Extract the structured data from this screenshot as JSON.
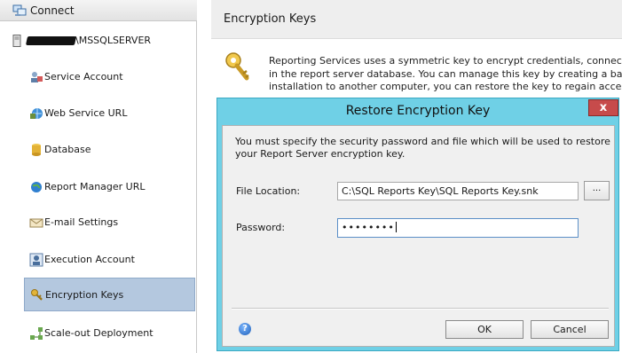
{
  "sidebar": {
    "connect_label": "Connect",
    "server_label": "\\MSSQLSERVER",
    "items": [
      {
        "label": "Service Account",
        "icon": "service-account-icon"
      },
      {
        "label": "Web Service URL",
        "icon": "web-service-icon"
      },
      {
        "label": "Database",
        "icon": "database-icon"
      },
      {
        "label": "Report Manager URL",
        "icon": "globe-icon"
      },
      {
        "label": "E-mail Settings",
        "icon": "email-icon"
      },
      {
        "label": "Execution Account",
        "icon": "execution-account-icon"
      },
      {
        "label": "Encryption Keys",
        "icon": "key-icon",
        "selected": true
      },
      {
        "label": "Scale-out Deployment",
        "icon": "scale-out-icon"
      }
    ],
    "selected_color": "#b4c8df"
  },
  "main": {
    "title": "Encryption Keys",
    "description": [
      "Reporting Services uses a symmetric key to encrypt credentials, connection stri",
      "in the report server database.  You can manage this key by creating a backup.",
      "installation to another computer, you can restore the key to regain access to en"
    ]
  },
  "dialog": {
    "title": "Restore Encryption Key",
    "close_label": "x",
    "message": "You must specify the security password and file which will be used to restore your Report Server encryption key.",
    "file_location_label": "File Location:",
    "file_location_value": "C:\\SQL Reports Key\\SQL Reports Key.snk",
    "browse_label": "...",
    "password_label": "Password:",
    "password_value": "••••••••",
    "ok_label": "OK",
    "cancel_label": "Cancel",
    "accent_color": "#6fd0e6"
  }
}
